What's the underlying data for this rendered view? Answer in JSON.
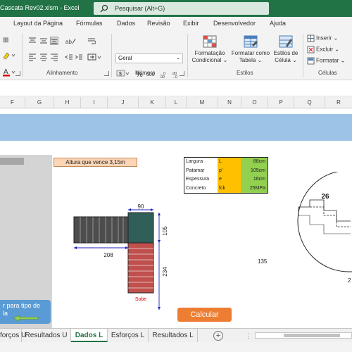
{
  "window": {
    "title": "Cascata Rev02.xlsm  -  Excel",
    "search_placeholder": "Pesquisar (Alt+G)"
  },
  "ribbon": {
    "tabs": [
      "Layout da Página",
      "Fórmulas",
      "Dados",
      "Revisão",
      "Exibir",
      "Desenvolvedor",
      "Ajuda"
    ],
    "groups": {
      "alignment": "Alinhamento",
      "number": "Número",
      "styles": "Estilos",
      "cells": "Células"
    },
    "number_format": "Geral",
    "percent_symbol": "%",
    "thousands_symbol": "000",
    "buttons": {
      "conditional_format": [
        "Formatação",
        "Condicional ⌄"
      ],
      "format_as_table": [
        "Formatar como",
        "Tabela ⌄"
      ],
      "cell_styles": [
        "Estilos de",
        "Célula ⌄"
      ],
      "insert": "Inserir ⌄",
      "delete": "Excluir ⌄",
      "format": "Formatar ⌄"
    },
    "colors": {
      "accent": "#217346",
      "font_red": "#e00000"
    }
  },
  "columns": [
    "F",
    "G",
    "H",
    "I",
    "J",
    "K",
    "L",
    "M",
    "N",
    "O",
    "P",
    "Q",
    "R"
  ],
  "sheet": {
    "altura_label": "Altura que vence 3,15m",
    "params": [
      {
        "name": "Largura",
        "symbol": "L",
        "value": "88cm"
      },
      {
        "name": "Patamar",
        "symbol": "p'",
        "value": "105cm"
      },
      {
        "name": "Espessura",
        "symbol": "e",
        "value": "16cm"
      },
      {
        "name": "Concreto",
        "symbol": "fck",
        "value": "25MPa"
      }
    ],
    "drawing": {
      "dim_top": "90",
      "dim_right": "105",
      "dim_left": "208",
      "dim_bottom": "234",
      "sobe_label": "Sobe",
      "detail_label": "26"
    },
    "side_value": "135",
    "edge_value": "2",
    "blue_button": [
      "r para tipo de",
      "la"
    ],
    "calc_button": "Calcular"
  },
  "sheet_tabs": [
    "forços U",
    "Resultados U",
    "Dados L",
    "Esforços L",
    "Resultados L"
  ],
  "active_sheet": "Dados L",
  "add_sheet": "+",
  "overflow_dots": "⋮"
}
